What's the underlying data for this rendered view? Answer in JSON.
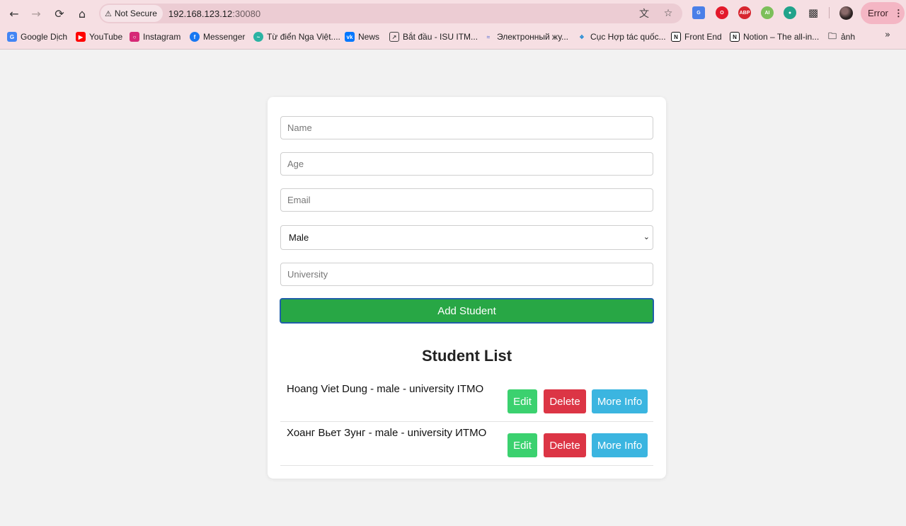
{
  "browser": {
    "security_label": "Not Secure",
    "url_host": "192.168.123.12",
    "url_port": ":30080",
    "profile_status": "Error",
    "extensions": [
      "google-translate-extension",
      "opera-extension",
      "adblock-plus-extension",
      "ai-extension",
      "shield-extension"
    ],
    "bookmarks": [
      {
        "label": "Google Dịch",
        "icon": "google-translate-icon",
        "color": "#4285f4"
      },
      {
        "label": "YouTube",
        "icon": "youtube-icon",
        "color": "#ff0000"
      },
      {
        "label": "Instagram",
        "icon": "instagram-icon",
        "color": "#d62976"
      },
      {
        "label": "Messenger",
        "icon": "facebook-icon",
        "color": "#1877f2"
      },
      {
        "label": "Từ điển Nga Việt....",
        "icon": "dictionary-icon",
        "color": "#2bb3a3"
      },
      {
        "label": "News",
        "icon": "vk-icon",
        "color": "#0077ff"
      },
      {
        "label": "Bắt đầu - ISU ITM...",
        "icon": "isu-icon",
        "color": "#555555"
      },
      {
        "label": "Электронный жу...",
        "icon": "journal-icon",
        "color": "#6a7bd6"
      },
      {
        "label": "Cục Hợp tác quốc...",
        "icon": "cooperation-icon",
        "color": "#2d8fd5"
      },
      {
        "label": "Front End",
        "icon": "notion-icon",
        "color": "#111111"
      },
      {
        "label": "Notion – The all-in...",
        "icon": "notion-icon",
        "color": "#111111"
      },
      {
        "label": "ảnh",
        "icon": "folder-icon",
        "color": "#555555"
      }
    ]
  },
  "form": {
    "name_placeholder": "Name",
    "age_placeholder": "Age",
    "email_placeholder": "Email",
    "gender_selected": "Male",
    "university_placeholder": "University",
    "submit_label": "Add Student"
  },
  "student_list": {
    "title": "Student List",
    "edit_label": "Edit",
    "delete_label": "Delete",
    "info_label": "More Info",
    "students": [
      {
        "text": "Hoang Viet Dung - male - university ITMO"
      },
      {
        "text": "Хоанг Вьет Зунг - male - university ИТМО"
      }
    ]
  },
  "colors": {
    "add_button": "#28a745",
    "edit_button": "#3bd16f",
    "delete_button": "#dc3545",
    "info_button": "#3bb5e0",
    "chrome_bg": "#f6dfe3"
  }
}
